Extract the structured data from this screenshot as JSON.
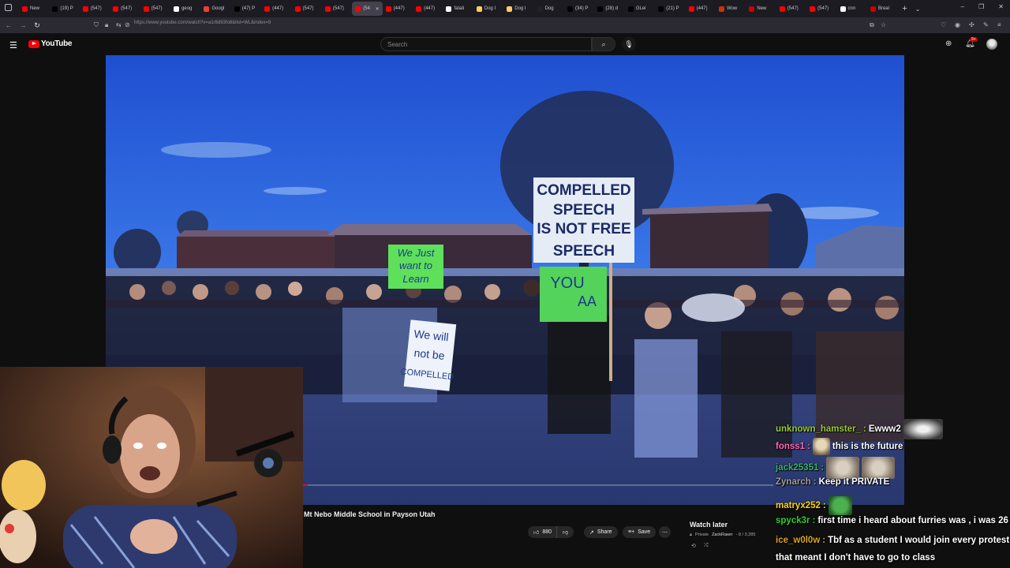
{
  "browser": {
    "tabs": [
      {
        "label": "New",
        "color": "#ff0000"
      },
      {
        "label": "(19) P",
        "color": "#000000"
      },
      {
        "label": "(547)",
        "color": "#ff0000"
      },
      {
        "label": "(547)",
        "color": "#ff0000"
      },
      {
        "label": "(547)",
        "color": "#ff0000"
      },
      {
        "label": "geog",
        "color": "#ffffff"
      },
      {
        "label": "Googl",
        "color": "#ea4335"
      },
      {
        "label": "(47) P",
        "color": "#000000"
      },
      {
        "label": "(447)",
        "color": "#ff0000"
      },
      {
        "label": "(547)",
        "color": "#ff0000"
      },
      {
        "label": "(547)",
        "color": "#ff0000"
      },
      {
        "label": "(54",
        "color": "#ff0000"
      },
      {
        "label": "(447)",
        "color": "#ff0000"
      },
      {
        "label": "(447)",
        "color": "#ff0000"
      },
      {
        "label": "fatali",
        "color": "#ffffff"
      },
      {
        "label": "Dog I",
        "color": "#ffcc66"
      },
      {
        "label": "Dog I",
        "color": "#ffcc66"
      },
      {
        "label": "Dog",
        "color": "#222222"
      },
      {
        "label": "(34) P",
        "color": "#000000"
      },
      {
        "label": "(28) d",
        "color": "#000000"
      },
      {
        "label": "GLei",
        "color": "#000000"
      },
      {
        "label": "(21) P",
        "color": "#000000"
      },
      {
        "label": "(447)",
        "color": "#ff0000"
      },
      {
        "label": "Wow",
        "color": "#cc3300"
      },
      {
        "label": "New",
        "color": "#cc0000"
      },
      {
        "label": "(547)",
        "color": "#ff0000"
      },
      {
        "label": "(547)",
        "color": "#ff0000"
      },
      {
        "label": "cnn",
        "color": "#ffffff"
      },
      {
        "label": "Breal",
        "color": "#cc0000"
      }
    ],
    "active_tab_index": 11,
    "new_tab": "+",
    "url": "https://www.youtube.com/watch?v=a1r8d93fo8&list=WL&index=9"
  },
  "youtube": {
    "logo_text": "YouTube",
    "search_placeholder": "Search",
    "notification_count": "9+"
  },
  "video": {
    "title": "Mt Nebo Middle School in Payson Utah",
    "signs": {
      "main": [
        "COMPELLED",
        "SPEECH",
        "IS NOT FREE",
        "SPEECH"
      ],
      "green_left": [
        "We Just",
        "want to",
        "Learn"
      ],
      "white_mid": [
        "We will",
        "not be",
        "COMPELLED"
      ],
      "green_right": [
        "YOU",
        "AA"
      ]
    },
    "progress": 0.01
  },
  "actions": {
    "like_count": "880",
    "share_label": "Share",
    "save_label": "Save",
    "more_label": "⋯"
  },
  "watch_later": {
    "title": "Watch later",
    "privacy": "Private",
    "owner": "ZackRawrr",
    "position": "- 8 / 3,285"
  },
  "chat": [
    {
      "user": "unknown_hamster_",
      "user_color": "#9acd32",
      "text": "Ewww2",
      "emotes": 1
    },
    {
      "user": "fonss1",
      "user_color": "#ff69b4",
      "text": "this is the future",
      "emotes": 1
    },
    {
      "user": "jack25351",
      "user_color": "#3cb371",
      "text": "",
      "emotes": 2
    },
    {
      "user": "Zynarch",
      "user_color": "#a0a0a0",
      "text": "Keep it PRIVATE",
      "emotes": 0
    },
    {
      "user": "matryx252",
      "user_color": "#ffd700",
      "text": "",
      "emotes": 1
    },
    {
      "user": "spyck3r",
      "user_color": "#32cd32",
      "text": "first time i heard about furries was , i was 26",
      "emotes": 0
    },
    {
      "user": "ice_w0l0w",
      "user_color": "#daa520",
      "text": "Tbf as a student I would join every protest",
      "emotes": 0
    },
    {
      "user": "",
      "user_color": "#ffffff",
      "text": "that meant I don't have to go to class",
      "emotes": 0
    }
  ],
  "colors": {
    "background": "#0f0f0f",
    "accent": "#ff0000",
    "chip": "#272727"
  }
}
